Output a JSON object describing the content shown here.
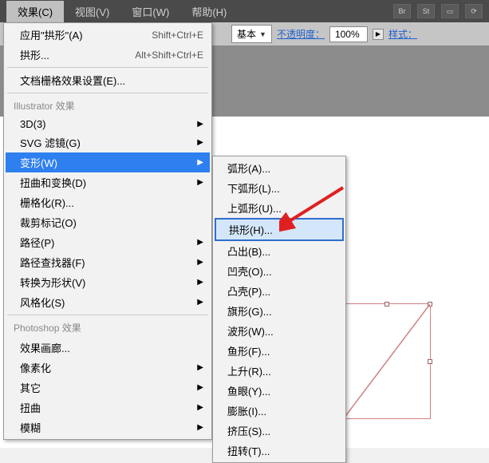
{
  "menubar": {
    "effects": "效果(C)",
    "view": "视图(V)",
    "window": "窗口(W)",
    "help": "帮助(H)"
  },
  "toolbar": {
    "basic_label": "基本",
    "opacity_label": "不透明度：",
    "opacity_value": "100%",
    "style_label": "样式："
  },
  "menu": {
    "apply_arch": "应用\"拱形\"(A)",
    "apply_arch_sc": "Shift+Ctrl+E",
    "arch": "拱形...",
    "arch_sc": "Alt+Shift+Ctrl+E",
    "doc_raster": "文档栅格效果设置(E)...",
    "illustrator_header": "Illustrator 效果",
    "3d": "3D(3)",
    "svg": "SVG 滤镜(G)",
    "transform": "变形(W)",
    "distort": "扭曲和变换(D)",
    "rasterize": "栅格化(R)...",
    "crop": "裁剪标记(O)",
    "path": "路径(P)",
    "pathfinder": "路径查找器(F)",
    "convert": "转换为形状(V)",
    "stylize": "风格化(S)",
    "photoshop_header": "Photoshop 效果",
    "gallery": "效果画廊...",
    "pixelate": "像素化",
    "other": "其它",
    "distort2": "扭曲",
    "blur": "模糊"
  },
  "submenu": {
    "arc": "弧形(A)...",
    "arc_lower": "下弧形(L)...",
    "arc_upper": "上弧形(U)...",
    "arch": "拱形(H)...",
    "bulge": "凸出(B)...",
    "shell_lower": "凹壳(O)...",
    "shell_upper": "凸壳(P)...",
    "flag": "旗形(G)...",
    "wave": "波形(W)...",
    "fish": "鱼形(F)...",
    "rise": "上升(R)...",
    "fisheye": "鱼眼(Y)...",
    "inflate": "膨胀(I)...",
    "squeeze": "挤压(S)...",
    "twist": "扭转(T)..."
  }
}
